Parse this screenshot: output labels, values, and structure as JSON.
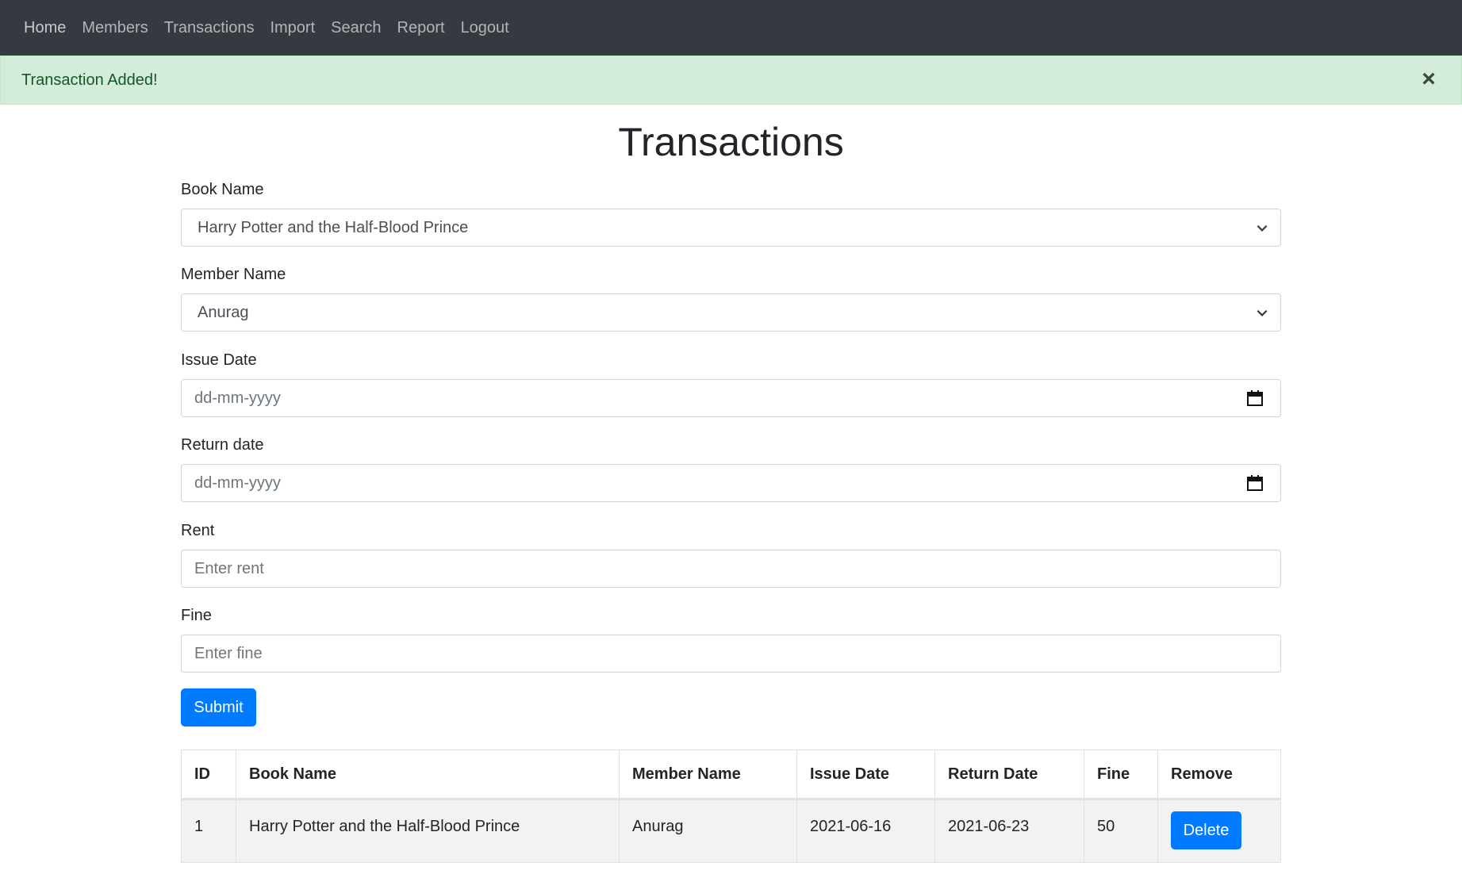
{
  "nav": {
    "items": [
      "Home",
      "Members",
      "Transactions",
      "Import",
      "Search",
      "Report",
      "Logout"
    ]
  },
  "alert": {
    "message": "Transaction Added!",
    "close": "×"
  },
  "page": {
    "title": "Transactions"
  },
  "form": {
    "book_name": {
      "label": "Book Name",
      "value": "Harry Potter and the Half-Blood Prince"
    },
    "member_name": {
      "label": "Member Name",
      "value": "Anurag"
    },
    "issue_date": {
      "label": "Issue Date",
      "placeholder": "dd-mm-yyyy"
    },
    "return_date": {
      "label": "Return date",
      "placeholder": "dd-mm-yyyy"
    },
    "rent": {
      "label": "Rent",
      "placeholder": "Enter rent"
    },
    "fine": {
      "label": "Fine",
      "placeholder": "Enter fine"
    },
    "submit_label": "Submit"
  },
  "table": {
    "headers": [
      "ID",
      "Book Name",
      "Member Name",
      "Issue Date",
      "Return Date",
      "Fine",
      "Remove"
    ],
    "rows": [
      {
        "id": "1",
        "book_name": "Harry Potter and the Half-Blood Prince",
        "member_name": "Anurag",
        "issue_date": "2021-06-16",
        "return_date": "2021-06-23",
        "fine": "50",
        "remove_label": "Delete"
      }
    ]
  },
  "colors": {
    "navbar": "#343a40",
    "alert_bg": "#d4edda",
    "alert_text": "#155724",
    "primary": "#007bff"
  }
}
